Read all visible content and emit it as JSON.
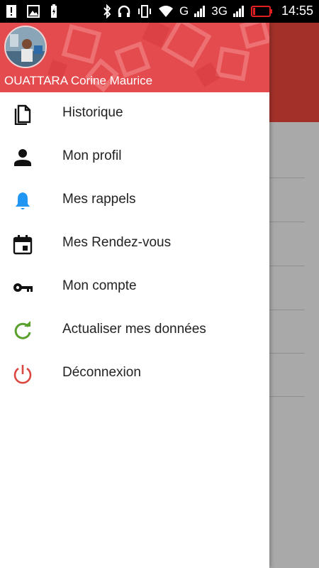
{
  "status_bar": {
    "time": "14:55",
    "network_g": "G",
    "network_3g": "3G",
    "left_icons": [
      "alert-icon",
      "image-icon",
      "battery-charging-icon"
    ],
    "right_icons": [
      "bluetooth-icon",
      "headphones-icon",
      "vibrate-icon",
      "wifi-icon",
      "signal-icon",
      "signal-icon",
      "battery-low-icon"
    ]
  },
  "colors": {
    "accent": "#e44b4e",
    "app_bar": "#a3312a",
    "scrim": "#a9a9a9"
  },
  "drawer": {
    "user_name": "OUATTARA Corine Maurice",
    "items": [
      {
        "label": "Historique",
        "icon": "document-icon"
      },
      {
        "label": "Mon profil",
        "icon": "person-icon"
      },
      {
        "label": "Mes rappels",
        "icon": "bell-icon"
      },
      {
        "label": "Mes Rendez-vous",
        "icon": "calendar-icon"
      },
      {
        "label": "Mon compte",
        "icon": "key-icon"
      },
      {
        "label": "Actualiser mes données",
        "icon": "refresh-icon"
      },
      {
        "label": "Déconnexion",
        "icon": "power-icon"
      }
    ]
  }
}
